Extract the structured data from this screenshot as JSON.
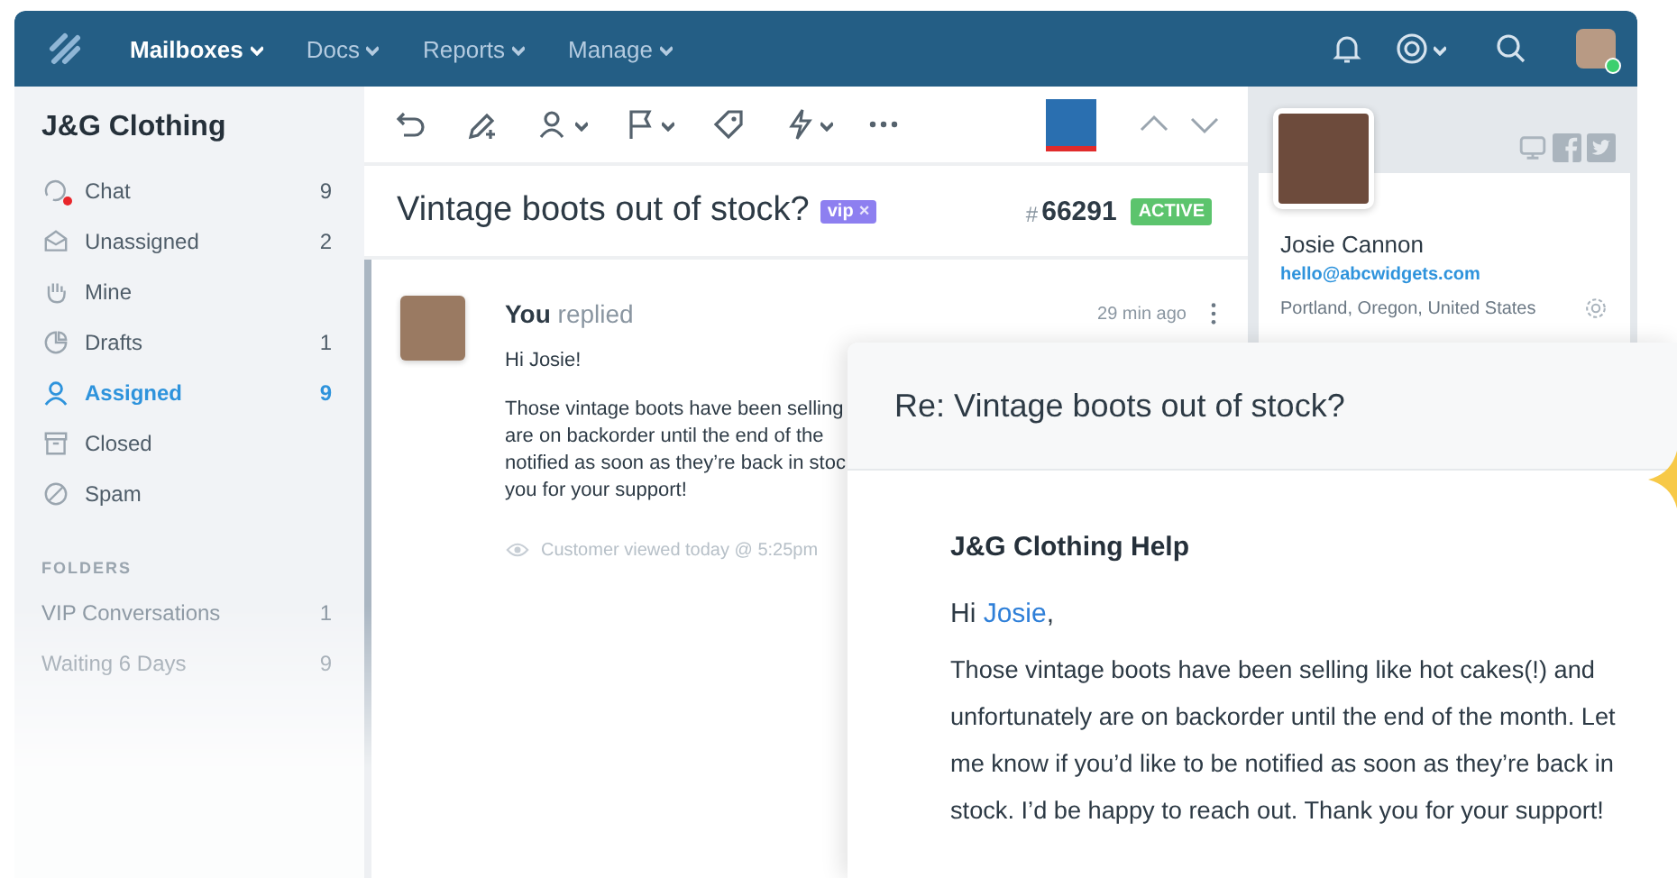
{
  "topbar": {
    "nav": [
      {
        "label": "Mailboxes",
        "selected": true
      },
      {
        "label": "Docs",
        "selected": false
      },
      {
        "label": "Reports",
        "selected": false
      },
      {
        "label": "Manage",
        "selected": false
      }
    ],
    "user_online": true
  },
  "sidebar": {
    "title": "J&G Clothing",
    "items": [
      {
        "kind": "chat",
        "label": "Chat",
        "count": "9",
        "selected": false,
        "unread": true
      },
      {
        "kind": "unassigned",
        "label": "Unassigned",
        "count": "2",
        "selected": false,
        "unread": false
      },
      {
        "kind": "mine",
        "label": "Mine",
        "selected": false,
        "unread": false
      },
      {
        "kind": "drafts",
        "label": "Drafts",
        "count": "1",
        "selected": false,
        "unread": false
      },
      {
        "kind": "assigned",
        "label": "Assigned",
        "count": "9",
        "selected": true,
        "unread": false
      },
      {
        "kind": "closed",
        "label": "Closed",
        "selected": false,
        "unread": false
      },
      {
        "kind": "spam",
        "label": "Spam",
        "selected": false,
        "unread": false
      }
    ],
    "folders_heading": "FOLDERS",
    "folders": [
      {
        "label": "VIP Conversations",
        "count": "1"
      },
      {
        "label": "Waiting 6 Days",
        "count": "9"
      }
    ]
  },
  "conversation": {
    "subject": "Vintage boots out of stock?",
    "tag": {
      "label": "vip",
      "remove": "×"
    },
    "hash": "#",
    "number": "66291",
    "status": "ACTIVE",
    "reply": {
      "author": "You",
      "action": "replied",
      "time": "29 min ago",
      "greeting": "Hi Josie!",
      "lines": [
        "Those vintage boots have been selling",
        "are on backorder until the end of the",
        "notified as soon as they’re back in stoc",
        "you for your support!"
      ],
      "viewed": "Customer viewed today @ 5:25pm"
    }
  },
  "customer": {
    "name": "Josie Cannon",
    "email": "hello@abcwidgets.com",
    "location": "Portland, Oregon, United States"
  },
  "email_preview": {
    "subject": "Re: Vintage boots out of stock?",
    "sender": "J&G Clothing Help",
    "greeting_prefix": "Hi ",
    "greeting_name": "Josie",
    "greeting_suffix": ",",
    "body": "Those vintage boots have been selling like hot cakes(!) and unfortunately are on backorder until the end of the month. Let me know if you’d like to be notified as soon as they’re back in stock. I’d be happy to reach out. Thank you for your support!"
  }
}
